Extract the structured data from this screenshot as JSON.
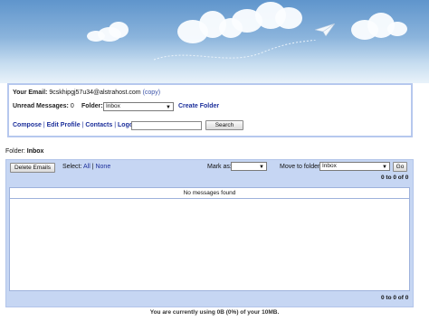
{
  "account": {
    "email_label": "Your Email:",
    "email_value": "9cskhipgj57u34@alstrahost.com",
    "copy_link": "(copy)",
    "unread_label": "Unread Messages:",
    "unread_count": "0",
    "folder_label": "Folder:",
    "folder_selected": "Inbox",
    "create_folder": "Create Folder"
  },
  "nav": {
    "compose": "Compose",
    "edit_profile": "Edit Profile",
    "contacts": "Contacts",
    "logout": "Logout",
    "separator": "|",
    "search_value": "",
    "search_button": "Search"
  },
  "folder_heading": {
    "label": "Folder:",
    "name": "Inbox"
  },
  "toolbar": {
    "delete_button": "Delete Emails",
    "select_label": "Select:",
    "select_all": "All",
    "select_none": "None",
    "mark_as_label": "Mark as:",
    "mark_as_value": "",
    "move_label": "Move to folder:",
    "move_value": "Inbox",
    "go_button": "Go",
    "count_top": "0 to 0 of 0",
    "count_bottom": "0 to 0 of 0"
  },
  "messages": {
    "empty_text": "No messages found"
  },
  "footer": {
    "usage_text": "You are currently using 0B (0%) of your 10MB."
  }
}
